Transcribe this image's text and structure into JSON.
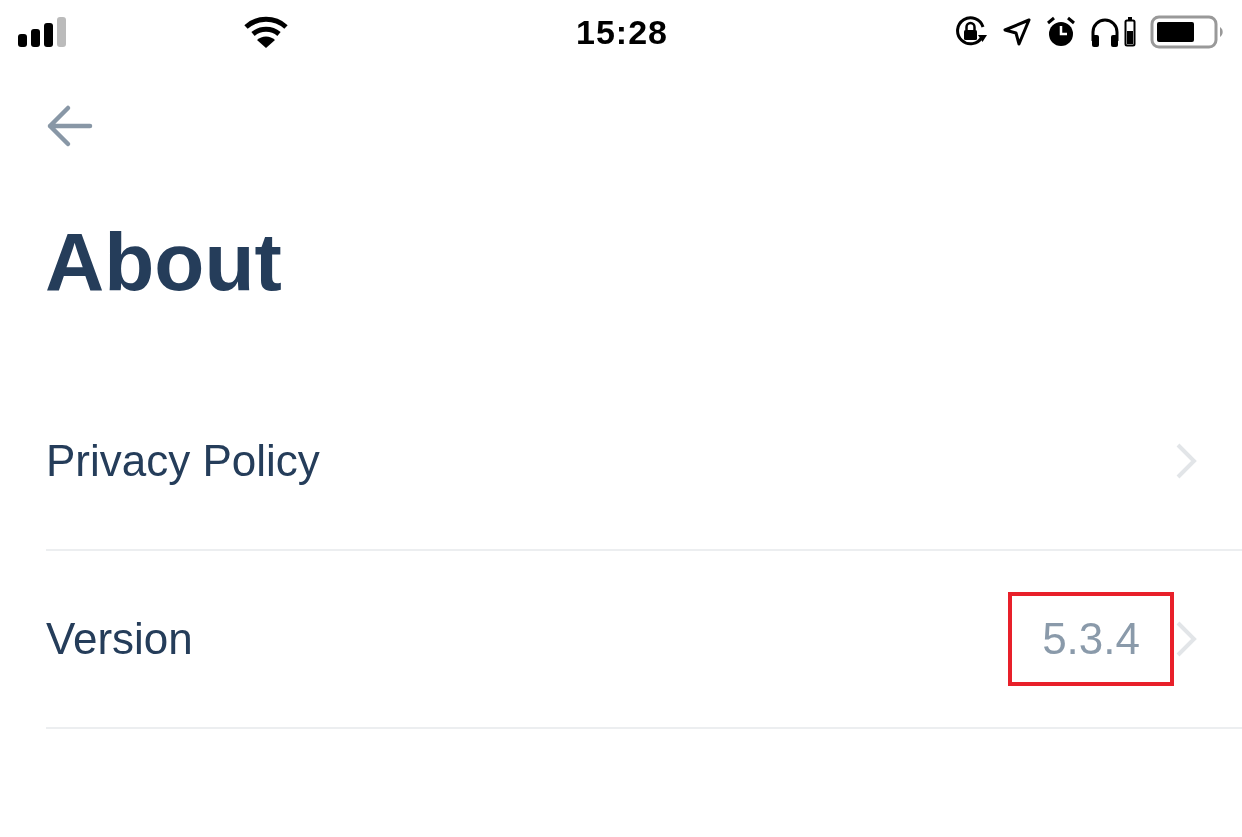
{
  "status_bar": {
    "time": "15:28"
  },
  "title": "About",
  "rows": [
    {
      "label": "Privacy Policy"
    },
    {
      "label": "Version",
      "value": "5.3.4",
      "highlighted": true
    }
  ]
}
